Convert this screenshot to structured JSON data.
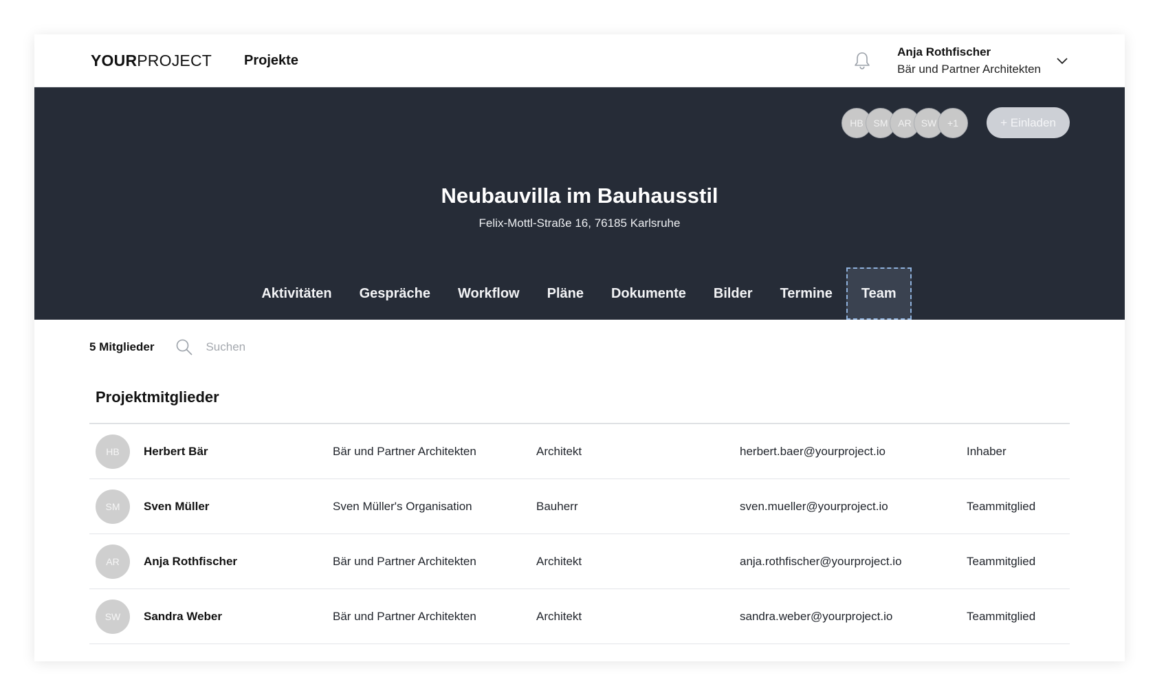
{
  "header": {
    "logo_bold": "YOUR",
    "logo_light": "PROJECT",
    "nav_projects": "Projekte",
    "user_name": "Anja Rothfischer",
    "user_org": "Bär und Partner Architekten"
  },
  "hero": {
    "avatars": [
      "HB",
      "SM",
      "AR",
      "SW",
      "+1"
    ],
    "invite_label": "+ Einladen",
    "title": "Neubauvilla im Bauhausstil",
    "address": "Felix-Mottl-Straße 16, 76185 Karlsruhe",
    "tabs": [
      "Aktivitäten",
      "Gespräche",
      "Workflow",
      "Pläne",
      "Dokumente",
      "Bilder",
      "Termine",
      "Team"
    ],
    "active_tab": "Team"
  },
  "toolbar": {
    "member_count": "5 Mitglieder",
    "search_placeholder": "Suchen"
  },
  "members": {
    "section_title": "Projektmitglieder",
    "rows": [
      {
        "initials": "HB",
        "name": "Herbert Bär",
        "org": "Bär und Partner Architekten",
        "role": "Architekt",
        "email": "herbert.baer@yourproject.io",
        "permission": "Inhaber"
      },
      {
        "initials": "SM",
        "name": "Sven Müller",
        "org": "Sven Müller's Organisation",
        "role": "Bauherr",
        "email": "sven.mueller@yourproject.io",
        "permission": "Teammitglied"
      },
      {
        "initials": "AR",
        "name": "Anja Rothfischer",
        "org": "Bär und Partner Architekten",
        "role": "Architekt",
        "email": "anja.rothfischer@yourproject.io",
        "permission": "Teammitglied"
      },
      {
        "initials": "SW",
        "name": "Sandra Weber",
        "org": "Bär und Partner Architekten",
        "role": "Architekt",
        "email": "sandra.weber@yourproject.io",
        "permission": "Teammitglied"
      }
    ]
  },
  "colors": {
    "hero_bg": "#262c37",
    "active_tab_bg": "#3a4250",
    "avatar_bg": "#cfcfcf"
  }
}
